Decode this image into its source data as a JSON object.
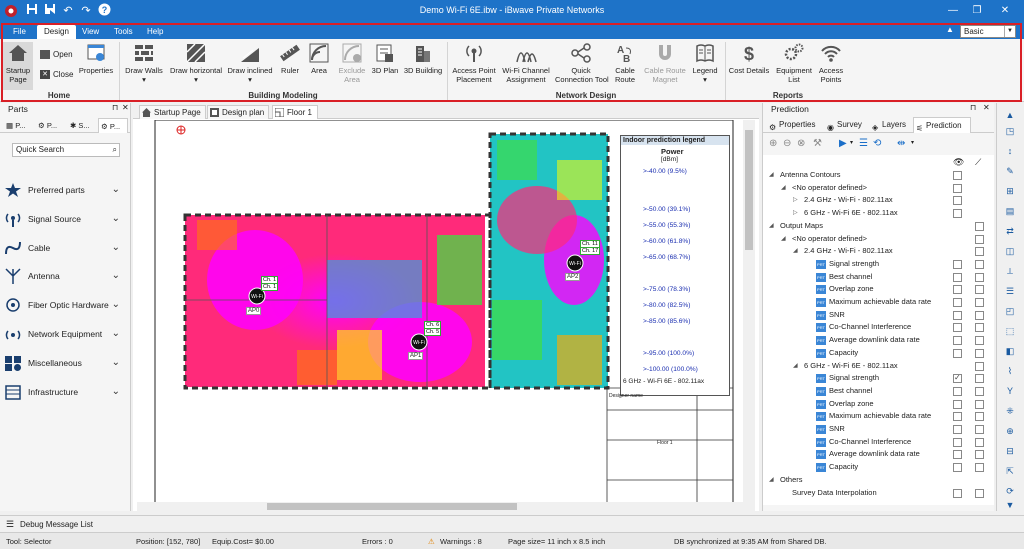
{
  "title_bar": {
    "title": "Demo Wi-Fi 6E.ibw - iBwave Private Networks"
  },
  "menu": {
    "tabs": [
      "File",
      "Design",
      "View",
      "Tools",
      "Help"
    ],
    "active": "Design",
    "mode": "Basic"
  },
  "ribbon": {
    "home": {
      "label": "Home",
      "startup_page": "Startup\nPage",
      "open": "Open",
      "close": "Close",
      "properties": "Properties"
    },
    "building_modeling": {
      "label": "Building Modeling",
      "draw_walls": "Draw Walls",
      "draw_horizontal": "Draw horizontal",
      "draw_inclined": "Draw inclined",
      "ruler": "Ruler",
      "area": "Area",
      "exclude_area": "Exclude\nArea",
      "plan_3d": "3D Plan",
      "building_3d": "3D Building"
    },
    "network_design": {
      "label": "Network Design",
      "ap_placement": "Access Point\nPlacement",
      "wifi_channel": "Wi-Fi Channel\nAssignment",
      "quick_connection": "Quick\nConnection Tool",
      "cable_route": "Cable\nRoute",
      "cable_route_magnet": "Cable Route\nMagnet",
      "legend": "Legend"
    },
    "reports": {
      "label": "Reports",
      "cost_details": "Cost Details",
      "equipment_list": "Equipment\nList",
      "access_points": "Access\nPoints"
    }
  },
  "parts": {
    "title": "Parts",
    "tabs": [
      "P...",
      "P...",
      "S...",
      "P..."
    ],
    "search_placeholder": "Quick Search",
    "items": [
      "Preferred parts",
      "Signal Source",
      "Cable",
      "Antenna",
      "Fiber Optic Hardware",
      "Network Equipment",
      "Miscellaneous",
      "Infrastructure"
    ]
  },
  "doc_tabs": [
    "Startup Page",
    "Design plan",
    "Floor 1"
  ],
  "legend": {
    "title": "Indoor prediction legend",
    "measure": "Power",
    "unit": "[dBm]",
    "ticks": [
      ">-40.00 (9.5%)",
      ">-50.00 (39.1%)",
      ">-55.00 (55.3%)",
      ">-60.00 (61.8%)",
      ">-65.00 (68.7%)",
      ">-75.00 (78.3%)",
      ">-80.00 (82.5%)",
      ">-85.00 (85.6%)",
      ">-95.00 (100.0%)",
      ">-100.00 (100.0%)"
    ],
    "band": "6 GHz - Wi-Fi 6E - 802.11ax"
  },
  "access_points": [
    {
      "name": "AP0",
      "channel": "Ch. 1",
      "channel2": "Ch. 1"
    },
    {
      "name": "AP1",
      "channel": "Ch. 6",
      "channel2": "Ch. 5"
    },
    {
      "name": "AP2",
      "channel": "Ch. 11",
      "channel2": "Ch. 17"
    }
  ],
  "floor_label": "Floor 1",
  "designer_label": "Designer name",
  "prediction": {
    "title": "Prediction",
    "tabs": [
      "Properties",
      "Survey",
      "Layers",
      "Prediction"
    ],
    "tree": [
      {
        "level": 0,
        "label": "Antenna Contours",
        "expanded": true,
        "col1": false
      },
      {
        "level": 1,
        "label": "<No operator defined>",
        "expanded": true,
        "col1": false
      },
      {
        "level": 2,
        "label": "2.4 GHz - Wi-Fi - 802.11ax",
        "expanded": false,
        "col1": false
      },
      {
        "level": 2,
        "label": "6 GHz - Wi-Fi 6E - 802.11ax",
        "expanded": false,
        "col1": false
      },
      {
        "level": 0,
        "label": "Output Maps",
        "expanded": true,
        "col2": false
      },
      {
        "level": 1,
        "label": "<No operator defined>",
        "expanded": true,
        "col2": false
      },
      {
        "level": 2,
        "label": "2.4 GHz - Wi-Fi - 802.11ax",
        "expanded": true,
        "col2": false
      },
      {
        "level": 3,
        "label": "Signal strength",
        "col1": false,
        "col2": false
      },
      {
        "level": 3,
        "label": "Best channel",
        "col1": false,
        "col2": false
      },
      {
        "level": 3,
        "label": "Overlap zone",
        "col1": false,
        "col2": false
      },
      {
        "level": 3,
        "label": "Maximum achievable data rate",
        "col1": false,
        "col2": false
      },
      {
        "level": 3,
        "label": "SNR",
        "col1": false,
        "col2": false
      },
      {
        "level": 3,
        "label": "Co-Channel Interference",
        "col1": false,
        "col2": false
      },
      {
        "level": 3,
        "label": "Average downlink data rate",
        "col1": false,
        "col2": false
      },
      {
        "level": 3,
        "label": "Capacity",
        "col1": false,
        "col2": false
      },
      {
        "level": 2,
        "label": "6 GHz - Wi-Fi 6E - 802.11ax",
        "expanded": true,
        "col2": false
      },
      {
        "level": 3,
        "label": "Signal strength",
        "col1": true,
        "col2": false
      },
      {
        "level": 3,
        "label": "Best channel",
        "col1": false,
        "col2": false
      },
      {
        "level": 3,
        "label": "Overlap zone",
        "col1": false,
        "col2": false
      },
      {
        "level": 3,
        "label": "Maximum achievable data rate",
        "col1": false,
        "col2": false
      },
      {
        "level": 3,
        "label": "SNR",
        "col1": false,
        "col2": false
      },
      {
        "level": 3,
        "label": "Co-Channel Interference",
        "col1": false,
        "col2": false
      },
      {
        "level": 3,
        "label": "Average downlink data rate",
        "col1": false,
        "col2": false
      },
      {
        "level": 3,
        "label": "Capacity",
        "col1": false,
        "col2": false
      },
      {
        "level": 0,
        "label": "Others",
        "expanded": true
      },
      {
        "level": 1,
        "label": "Survey Data Interpolation",
        "col1": false,
        "col2": false
      }
    ]
  },
  "debug": {
    "label": "Debug Message List"
  },
  "status": {
    "tool": "Tool: Selector",
    "position": "Position:  [152, 780]",
    "cost": "Equip.Cost= $0.00",
    "errors": "Errors : 0",
    "warnings": "Warnings : 8",
    "page_size": "Page size= 11 inch x 8.5 inch",
    "sync": "DB synchronized at 9:35 AM from Shared DB."
  },
  "colors": {
    "brand": "#1e73c8",
    "highlight": "#d91f26"
  }
}
